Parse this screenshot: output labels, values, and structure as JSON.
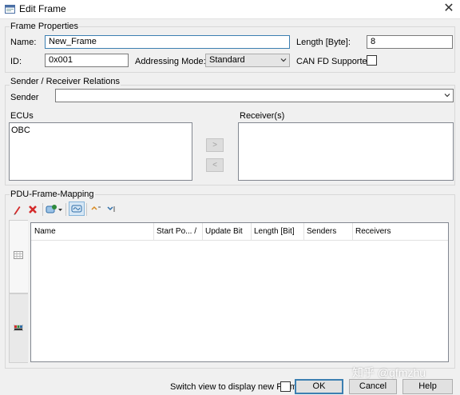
{
  "window": {
    "title": "Edit Frame",
    "close_symbol": "✕"
  },
  "frame_properties": {
    "group_label": "Frame Properties",
    "name_label": "Name:",
    "name_value": "New_Frame",
    "length_label": "Length [Byte]:",
    "length_value": "8",
    "id_label": "ID:",
    "id_value": "0x001",
    "addressing_label": "Addressing Mode:",
    "addressing_value": "Standard",
    "canfd_label": "CAN FD Supported:",
    "canfd_checked": false
  },
  "relations": {
    "group_label": "Sender / Receiver Relations",
    "sender_label": "Sender",
    "sender_value": "",
    "ecus_label": "ECUs",
    "ecus": [
      "OBC"
    ],
    "receivers_label": "Receiver(s)",
    "receivers": [],
    "add_symbol": ">",
    "remove_symbol": "<"
  },
  "mapping": {
    "group_label": "PDU-Frame-Mapping",
    "columns": [
      "Name",
      "Start Po... /",
      "Update Bit",
      "Length [Bit]",
      "Senders",
      "Receivers"
    ],
    "rows": []
  },
  "footer": {
    "switch_view_label": "Switch view to display new Frame",
    "switch_view_checked": false,
    "ok_label": "OK",
    "cancel_label": "Cancel",
    "help_label": "Help"
  },
  "watermark": "知乎 @qfmzhu",
  "colors": {
    "focus_border": "#3c7fb1",
    "window_bg": "#f0f0f0",
    "delete_red": "#d42a2a"
  }
}
